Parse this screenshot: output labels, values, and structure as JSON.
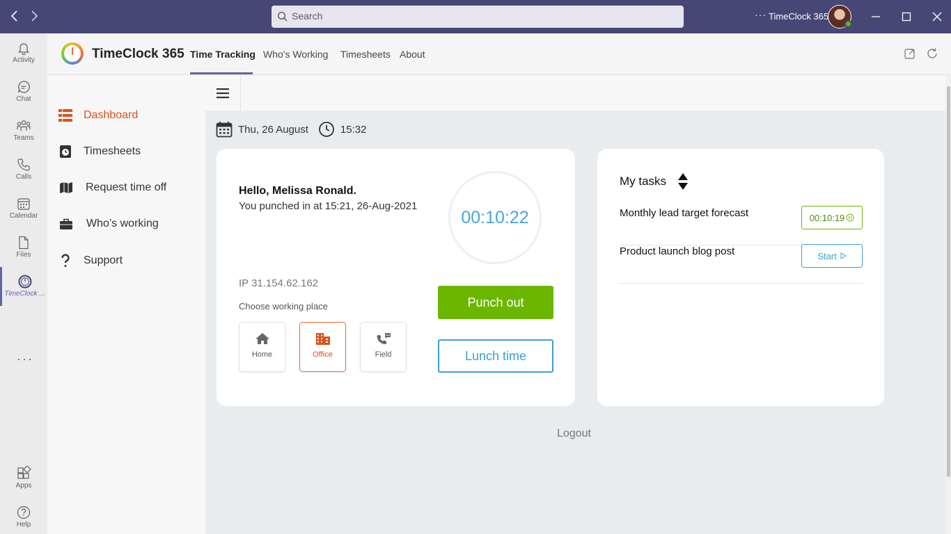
{
  "titlebar": {
    "search_placeholder": "Search",
    "more_dots": "···",
    "app_name": "TimeClock 365"
  },
  "rail": {
    "items": [
      {
        "label": "Activity",
        "icon": "bell-icon"
      },
      {
        "label": "Chat",
        "icon": "chat-icon"
      },
      {
        "label": "Teams",
        "icon": "teams-icon"
      },
      {
        "label": "Calls",
        "icon": "phone-icon"
      },
      {
        "label": "Calendar",
        "icon": "calendar-icon"
      },
      {
        "label": "Files",
        "icon": "file-icon"
      },
      {
        "label": "TimeClock ...",
        "icon": "timeclock-icon"
      }
    ],
    "more": "···",
    "apps_label": "Apps",
    "help_label": "Help"
  },
  "header": {
    "app_name": "TimeClock 365",
    "tabs": [
      {
        "label": "Time Tracking",
        "active": true
      },
      {
        "label": "Who's Working"
      },
      {
        "label": "Timesheets"
      },
      {
        "label": "About"
      }
    ]
  },
  "sidemenu": {
    "items": [
      {
        "label": "Dashboard",
        "icon": "dashboard-icon",
        "active": true
      },
      {
        "label": "Timesheets",
        "icon": "timesheet-icon"
      },
      {
        "label": "Request time off",
        "icon": "map-icon"
      },
      {
        "label": "Who’s working",
        "icon": "briefcase-icon"
      },
      {
        "label": "Support",
        "icon": "question-icon"
      }
    ]
  },
  "status": {
    "date": "Thu, 26 August",
    "time": "15:32"
  },
  "punch": {
    "greeting": "Hello, Melissa Ronald.",
    "punched_in": "You punched in at 15:21, 26-Aug-2021",
    "elapsed": "00:10:22",
    "ip_label": "IP",
    "ip": "31.154.62.162",
    "choose_label": "Choose working place",
    "places": [
      {
        "label": "Home",
        "icon": "home-icon"
      },
      {
        "label": "Office",
        "icon": "office-icon",
        "active": true
      },
      {
        "label": "Field",
        "icon": "field-phone-icon"
      }
    ],
    "punch_out_label": "Punch out",
    "lunch_label": "Lunch time"
  },
  "tasks": {
    "title": "My tasks",
    "items": [
      {
        "name": "Monthly lead target forecast",
        "timer": "00:10:19"
      },
      {
        "name": "Product launch blog post",
        "action": "Start"
      }
    ]
  },
  "logout_label": "Logout",
  "colors": {
    "titlebar": "#464775",
    "accent_orange": "#d9531e",
    "green": "#6bb700",
    "blue": "#3aa0d2",
    "teams_purple": "#6264a7"
  }
}
